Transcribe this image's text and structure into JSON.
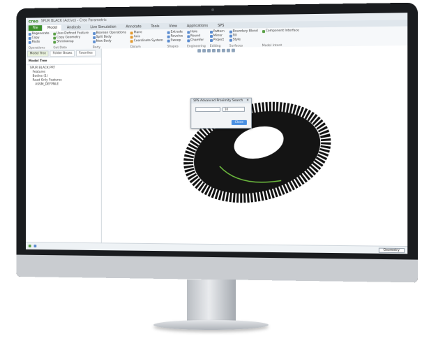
{
  "app": {
    "logo": "creo",
    "title": "SPUR BLACK (Active) - Creo Parametric"
  },
  "tabs": [
    "File",
    "Model",
    "Analysis",
    "Live Simulation",
    "Annotate",
    "Tools",
    "View",
    "Applications",
    "SPS"
  ],
  "ribbon": {
    "groups": [
      {
        "label": "Operations",
        "items": [
          "Regenerate",
          "Copy",
          "Paste",
          "Delete"
        ]
      },
      {
        "label": "Get Data",
        "items": [
          "User-Defined Feature",
          "Copy Geometry",
          "Shrinkwrap"
        ]
      },
      {
        "label": "Body",
        "items": [
          "Boolean Operations",
          "Split Body",
          "New Body"
        ]
      },
      {
        "label": "Datum",
        "items": [
          "Plane",
          "Axis",
          "Point",
          "Coordinate System"
        ]
      },
      {
        "label": "Shapes",
        "items": [
          "Extrude",
          "Revolve",
          "Sweep",
          "Swept Blend"
        ]
      },
      {
        "label": "Engineering",
        "items": [
          "Hole",
          "Round",
          "Chamfer",
          "Draft",
          "Shell",
          "Rib"
        ]
      },
      {
        "label": "Editing",
        "items": [
          "Pattern",
          "Mirror",
          "Extend",
          "Project",
          "Trim",
          "Offset",
          "Thicken"
        ]
      },
      {
        "label": "Surfaces",
        "items": [
          "Boundary Blend",
          "Fill",
          "Style",
          "Freestyle"
        ]
      },
      {
        "label": "Model Intent",
        "items": [
          "Component Interface"
        ]
      }
    ]
  },
  "sidebar": {
    "tabs": [
      "Model Tree",
      "Folder Brows",
      "Favorites"
    ],
    "header": "Model Tree",
    "tree": [
      "SPUR BLACK.PRT",
      "Features",
      "Bodies (1)",
      "Read Only Features",
      "ASSM_DEFPNLE"
    ]
  },
  "dialog": {
    "title": "SPS Advanced Proximity Search",
    "field_value": "10",
    "button": "Close"
  },
  "status": {
    "selection": "Geometry"
  }
}
